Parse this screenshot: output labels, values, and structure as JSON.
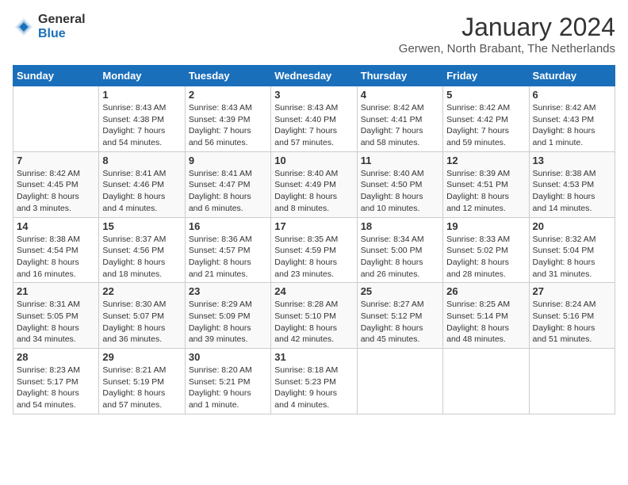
{
  "logo": {
    "general": "General",
    "blue": "Blue"
  },
  "title": "January 2024",
  "subtitle": "Gerwen, North Brabant, The Netherlands",
  "days_of_week": [
    "Sunday",
    "Monday",
    "Tuesday",
    "Wednesday",
    "Thursday",
    "Friday",
    "Saturday"
  ],
  "weeks": [
    [
      {
        "day": "",
        "info": ""
      },
      {
        "day": "1",
        "info": "Sunrise: 8:43 AM\nSunset: 4:38 PM\nDaylight: 7 hours\nand 54 minutes."
      },
      {
        "day": "2",
        "info": "Sunrise: 8:43 AM\nSunset: 4:39 PM\nDaylight: 7 hours\nand 56 minutes."
      },
      {
        "day": "3",
        "info": "Sunrise: 8:43 AM\nSunset: 4:40 PM\nDaylight: 7 hours\nand 57 minutes."
      },
      {
        "day": "4",
        "info": "Sunrise: 8:42 AM\nSunset: 4:41 PM\nDaylight: 7 hours\nand 58 minutes."
      },
      {
        "day": "5",
        "info": "Sunrise: 8:42 AM\nSunset: 4:42 PM\nDaylight: 7 hours\nand 59 minutes."
      },
      {
        "day": "6",
        "info": "Sunrise: 8:42 AM\nSunset: 4:43 PM\nDaylight: 8 hours\nand 1 minute."
      }
    ],
    [
      {
        "day": "7",
        "info": "Sunrise: 8:42 AM\nSunset: 4:45 PM\nDaylight: 8 hours\nand 3 minutes."
      },
      {
        "day": "8",
        "info": "Sunrise: 8:41 AM\nSunset: 4:46 PM\nDaylight: 8 hours\nand 4 minutes."
      },
      {
        "day": "9",
        "info": "Sunrise: 8:41 AM\nSunset: 4:47 PM\nDaylight: 8 hours\nand 6 minutes."
      },
      {
        "day": "10",
        "info": "Sunrise: 8:40 AM\nSunset: 4:49 PM\nDaylight: 8 hours\nand 8 minutes."
      },
      {
        "day": "11",
        "info": "Sunrise: 8:40 AM\nSunset: 4:50 PM\nDaylight: 8 hours\nand 10 minutes."
      },
      {
        "day": "12",
        "info": "Sunrise: 8:39 AM\nSunset: 4:51 PM\nDaylight: 8 hours\nand 12 minutes."
      },
      {
        "day": "13",
        "info": "Sunrise: 8:38 AM\nSunset: 4:53 PM\nDaylight: 8 hours\nand 14 minutes."
      }
    ],
    [
      {
        "day": "14",
        "info": "Sunrise: 8:38 AM\nSunset: 4:54 PM\nDaylight: 8 hours\nand 16 minutes."
      },
      {
        "day": "15",
        "info": "Sunrise: 8:37 AM\nSunset: 4:56 PM\nDaylight: 8 hours\nand 18 minutes."
      },
      {
        "day": "16",
        "info": "Sunrise: 8:36 AM\nSunset: 4:57 PM\nDaylight: 8 hours\nand 21 minutes."
      },
      {
        "day": "17",
        "info": "Sunrise: 8:35 AM\nSunset: 4:59 PM\nDaylight: 8 hours\nand 23 minutes."
      },
      {
        "day": "18",
        "info": "Sunrise: 8:34 AM\nSunset: 5:00 PM\nDaylight: 8 hours\nand 26 minutes."
      },
      {
        "day": "19",
        "info": "Sunrise: 8:33 AM\nSunset: 5:02 PM\nDaylight: 8 hours\nand 28 minutes."
      },
      {
        "day": "20",
        "info": "Sunrise: 8:32 AM\nSunset: 5:04 PM\nDaylight: 8 hours\nand 31 minutes."
      }
    ],
    [
      {
        "day": "21",
        "info": "Sunrise: 8:31 AM\nSunset: 5:05 PM\nDaylight: 8 hours\nand 34 minutes."
      },
      {
        "day": "22",
        "info": "Sunrise: 8:30 AM\nSunset: 5:07 PM\nDaylight: 8 hours\nand 36 minutes."
      },
      {
        "day": "23",
        "info": "Sunrise: 8:29 AM\nSunset: 5:09 PM\nDaylight: 8 hours\nand 39 minutes."
      },
      {
        "day": "24",
        "info": "Sunrise: 8:28 AM\nSunset: 5:10 PM\nDaylight: 8 hours\nand 42 minutes."
      },
      {
        "day": "25",
        "info": "Sunrise: 8:27 AM\nSunset: 5:12 PM\nDaylight: 8 hours\nand 45 minutes."
      },
      {
        "day": "26",
        "info": "Sunrise: 8:25 AM\nSunset: 5:14 PM\nDaylight: 8 hours\nand 48 minutes."
      },
      {
        "day": "27",
        "info": "Sunrise: 8:24 AM\nSunset: 5:16 PM\nDaylight: 8 hours\nand 51 minutes."
      }
    ],
    [
      {
        "day": "28",
        "info": "Sunrise: 8:23 AM\nSunset: 5:17 PM\nDaylight: 8 hours\nand 54 minutes."
      },
      {
        "day": "29",
        "info": "Sunrise: 8:21 AM\nSunset: 5:19 PM\nDaylight: 8 hours\nand 57 minutes."
      },
      {
        "day": "30",
        "info": "Sunrise: 8:20 AM\nSunset: 5:21 PM\nDaylight: 9 hours\nand 1 minute."
      },
      {
        "day": "31",
        "info": "Sunrise: 8:18 AM\nSunset: 5:23 PM\nDaylight: 9 hours\nand 4 minutes."
      },
      {
        "day": "",
        "info": ""
      },
      {
        "day": "",
        "info": ""
      },
      {
        "day": "",
        "info": ""
      }
    ]
  ]
}
